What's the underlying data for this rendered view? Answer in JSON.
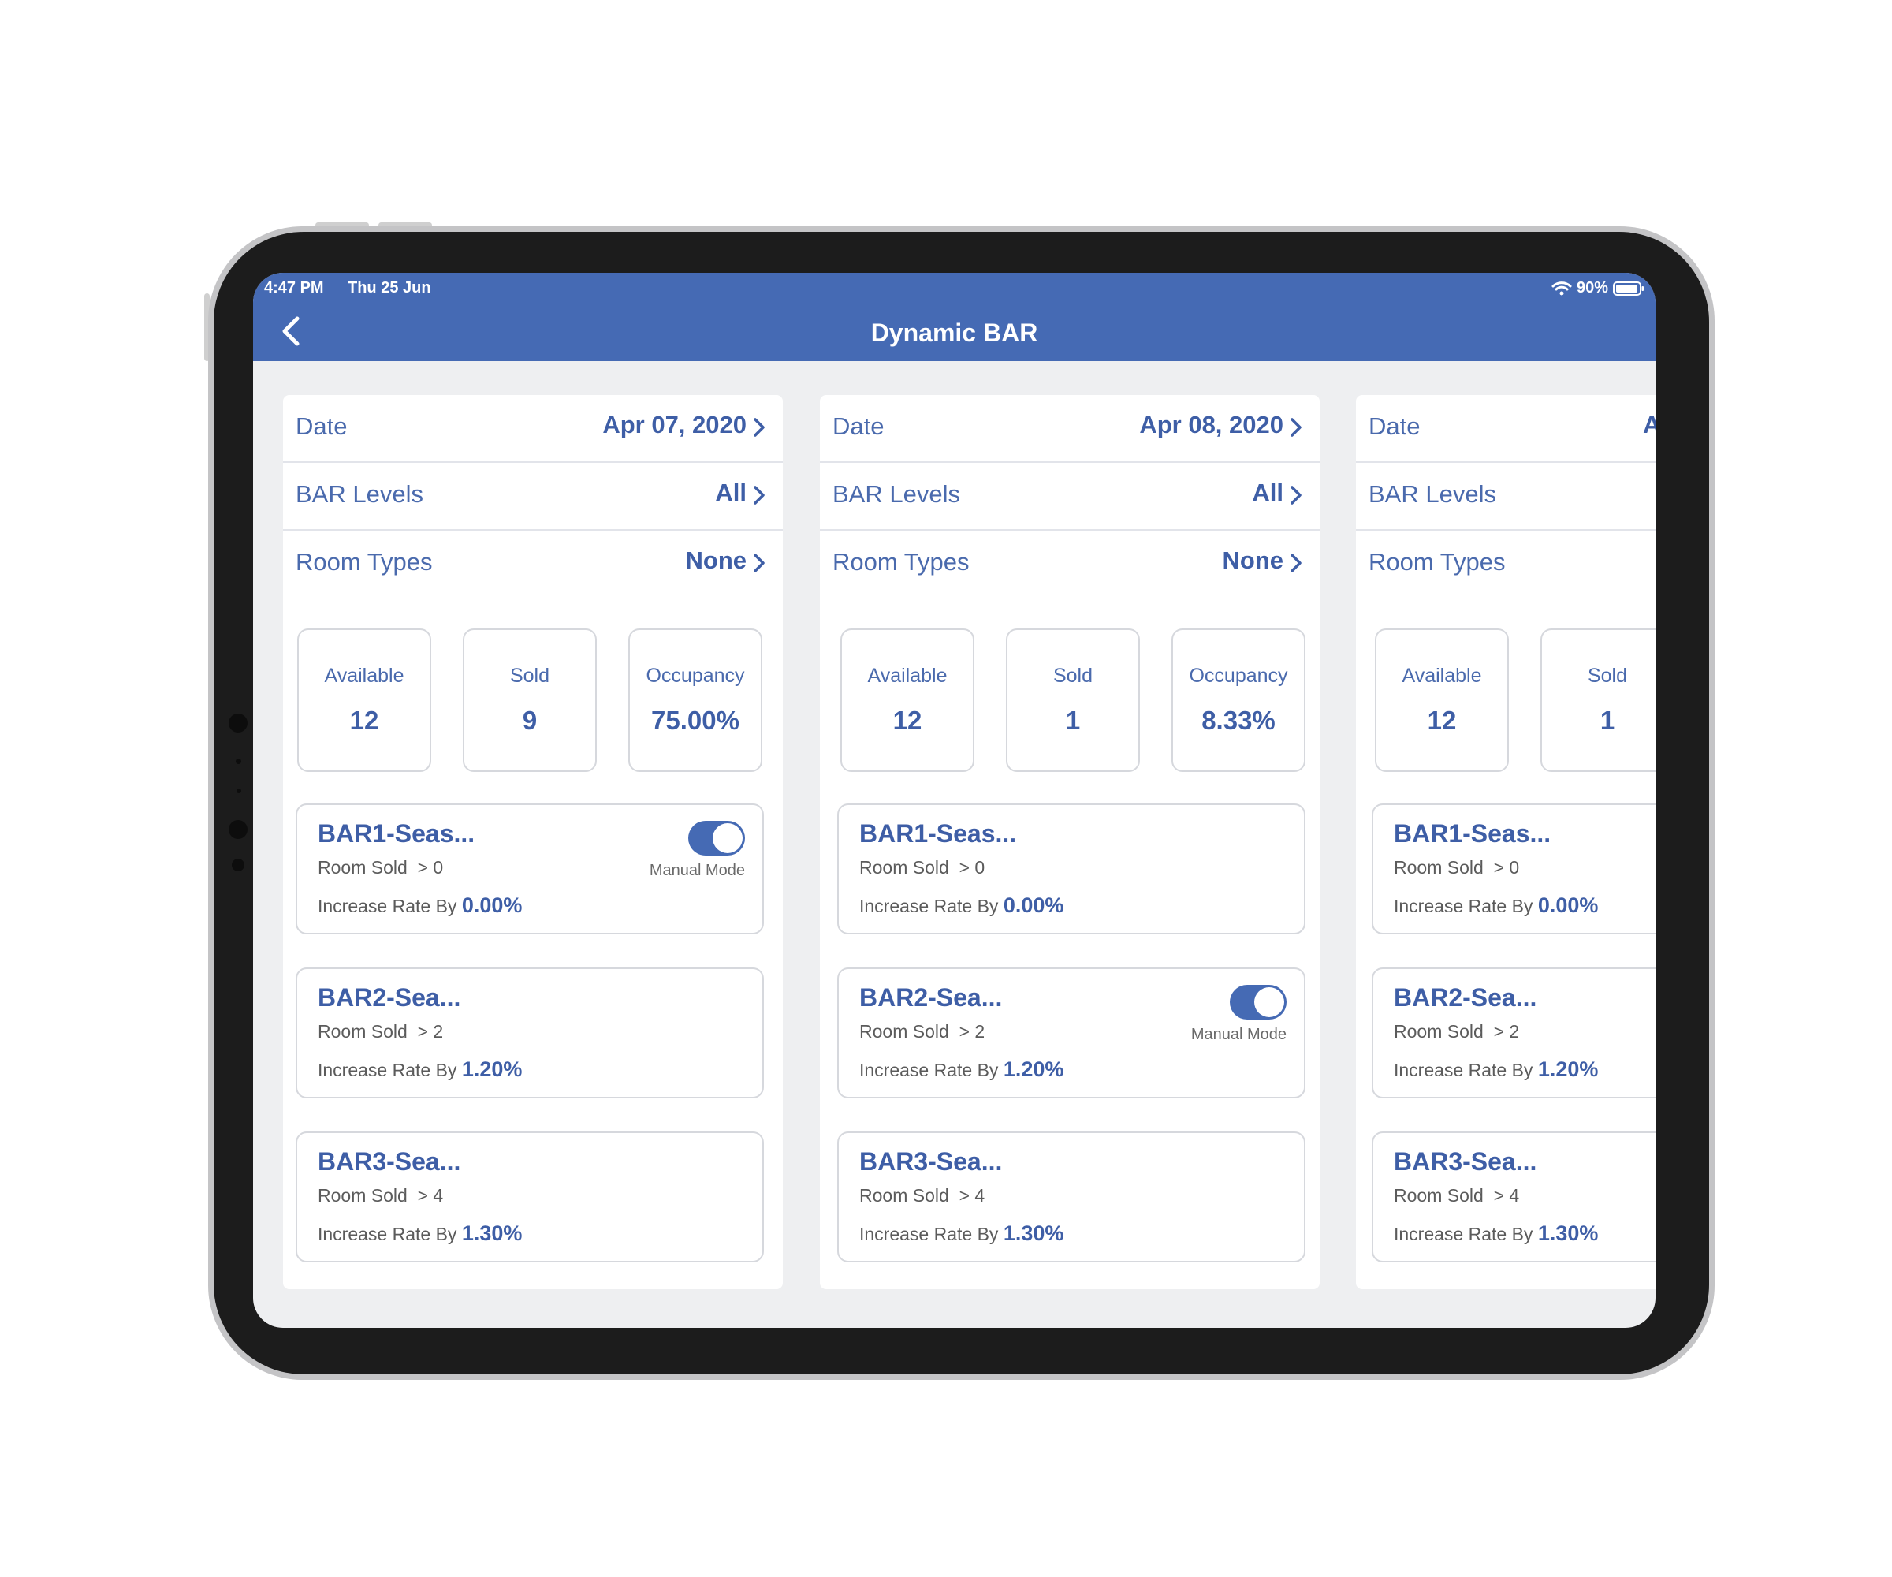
{
  "status": {
    "time": "4:47 PM",
    "date": "Thu 25 Jun",
    "battery": "90%"
  },
  "header": {
    "title": "Dynamic BAR"
  },
  "labels": {
    "date": "Date",
    "bar_levels": "BAR Levels",
    "room_types": "Room Types",
    "available": "Available",
    "sold": "Sold",
    "occupancy": "Occupancy",
    "room_sold": "Room Sold",
    "increase_rate_by": "Increase Rate By",
    "manual_mode": "Manual Mode"
  },
  "columns": [
    {
      "date": "Apr 07, 2020",
      "bar_levels": "All",
      "room_types": "None",
      "available": "12",
      "sold": "9",
      "occupancy": "75.00%",
      "bars": [
        {
          "name": "BAR1-Seas...",
          "room_sold": "> 0",
          "rate": "0.00%",
          "manual": true
        },
        {
          "name": "BAR2-Sea...",
          "room_sold": "> 2",
          "rate": "1.20%",
          "manual": false
        },
        {
          "name": "BAR3-Sea...",
          "room_sold": "> 4",
          "rate": "1.30%",
          "manual": false
        }
      ]
    },
    {
      "date": "Apr 08, 2020",
      "bar_levels": "All",
      "room_types": "None",
      "available": "12",
      "sold": "1",
      "occupancy": "8.33%",
      "bars": [
        {
          "name": "BAR1-Seas...",
          "room_sold": "> 0",
          "rate": "0.00%",
          "manual": false
        },
        {
          "name": "BAR2-Sea...",
          "room_sold": "> 2",
          "rate": "1.20%",
          "manual": true
        },
        {
          "name": "BAR3-Sea...",
          "room_sold": "> 4",
          "rate": "1.30%",
          "manual": false
        }
      ]
    },
    {
      "date": "A",
      "bar_levels": "",
      "room_types": "",
      "available": "12",
      "sold": "1",
      "bars": [
        {
          "name": "BAR1-Seas...",
          "room_sold": "> 0",
          "rate": "0.00%",
          "manual": false
        },
        {
          "name": "BAR2-Sea...",
          "room_sold": "> 2",
          "rate": "1.20%",
          "manual": false
        },
        {
          "name": "BAR3-Sea...",
          "room_sold": "> 4",
          "rate": "1.30%",
          "manual": false
        }
      ]
    }
  ],
  "colors": {
    "header_blue": "#456ab4",
    "text_blue": "#3e5ea6",
    "background": "#eeeff1"
  }
}
